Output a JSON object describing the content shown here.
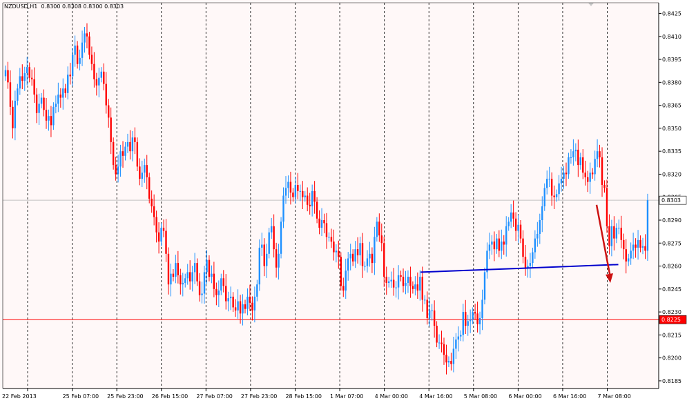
{
  "header": {
    "symbol": "NZDUSD,H1",
    "ohlc": "0.8300 0.8308 0.8300 0.8303"
  },
  "colors": {
    "background": "#fff8f8",
    "bull": "#1e90ff",
    "bear": "#ff0000",
    "grid": "#000000",
    "support_line": "#0000cd",
    "arrow": "#cc1111",
    "price_line": "#c0c0c0",
    "level_line": "#ff0000"
  },
  "chart_data": {
    "type": "candlestick",
    "title": "NZDUSD,H1",
    "ylim": [
      0.818,
      0.8432
    ],
    "y_ticks": [
      "0.8425",
      "0.8410",
      "0.8395",
      "0.8380",
      "0.8365",
      "0.8350",
      "0.8335",
      "0.8320",
      "0.8305",
      "0.8290",
      "0.8275",
      "0.8260",
      "0.8245",
      "0.8230",
      "0.8215",
      "0.8200",
      "0.8185"
    ],
    "x_ticks": [
      "22 Feb 2013",
      "25 Feb 07:00",
      "25 Feb 23:00",
      "26 Feb 15:00",
      "27 Feb 07:00",
      "27 Feb 23:00",
      "28 Feb 15:00",
      "1 Mar 07:00",
      "4 Mar 00:00",
      "4 Mar 16:00",
      "5 Mar 08:00",
      "6 Mar 00:00",
      "6 Mar 16:00",
      "7 Mar 08:00"
    ],
    "current_price": "0.8303",
    "horizontal_level": "0.8225",
    "trendline": {
      "from": [
        "4 Mar 16:00",
        0.8256
      ],
      "to": [
        "7 Mar 08:00",
        0.8261
      ]
    },
    "forecast_arrow": {
      "from_price": 0.83,
      "to_price": 0.8249,
      "direction": "down"
    },
    "closes": [
      0.8388,
      0.838,
      0.8364,
      0.835,
      0.8368,
      0.8376,
      0.8384,
      0.8381,
      0.8386,
      0.839,
      0.8383,
      0.8382,
      0.8372,
      0.836,
      0.8366,
      0.837,
      0.8362,
      0.8355,
      0.8358,
      0.8352,
      0.8364,
      0.8366,
      0.8372,
      0.837,
      0.8376,
      0.8373,
      0.8385,
      0.8384,
      0.8398,
      0.8404,
      0.8392,
      0.8396,
      0.8406,
      0.8412,
      0.841,
      0.8398,
      0.8392,
      0.8382,
      0.8378,
      0.8383,
      0.8387,
      0.8379,
      0.8365,
      0.8357,
      0.8341,
      0.8326,
      0.832,
      0.8325,
      0.8335,
      0.8332,
      0.8338,
      0.8341,
      0.8335,
      0.8344,
      0.8341,
      0.8325,
      0.8317,
      0.8321,
      0.8326,
      0.8318,
      0.8304,
      0.8299,
      0.8292,
      0.8282,
      0.8276,
      0.8285,
      0.8283,
      0.8268,
      0.8248,
      0.8255,
      0.8253,
      0.8262,
      0.8254,
      0.8248,
      0.8249,
      0.8252,
      0.8256,
      0.825,
      0.8256,
      0.8262,
      0.825,
      0.8241,
      0.8242,
      0.8256,
      0.8264,
      0.8253,
      0.8255,
      0.8245,
      0.8241,
      0.8244,
      0.8252,
      0.8247,
      0.8237,
      0.8239,
      0.824,
      0.8233,
      0.8231,
      0.8237,
      0.8229,
      0.8235,
      0.8232,
      0.824,
      0.8236,
      0.8231,
      0.824,
      0.8248,
      0.8272,
      0.8274,
      0.826,
      0.8268,
      0.8282,
      0.8286,
      0.8271,
      0.8259,
      0.8268,
      0.8289,
      0.8306,
      0.8311,
      0.8315,
      0.8308,
      0.8305,
      0.8313,
      0.8309,
      0.8309,
      0.8305,
      0.8306,
      0.83,
      0.8299,
      0.8309,
      0.8302,
      0.8291,
      0.8285,
      0.829,
      0.8288,
      0.8279,
      0.8279,
      0.8276,
      0.8269,
      0.827,
      0.8266,
      0.8247,
      0.8244,
      0.8257,
      0.8265,
      0.8268,
      0.8263,
      0.8271,
      0.8267,
      0.8275,
      0.826,
      0.826,
      0.8265,
      0.8268,
      0.8262,
      0.8279,
      0.8289,
      0.828,
      0.8275,
      0.8253,
      0.8249,
      0.825,
      0.8251,
      0.8246,
      0.8246,
      0.8254,
      0.8253,
      0.8247,
      0.8249,
      0.8253,
      0.8247,
      0.8245,
      0.8248,
      0.8244,
      0.8253,
      0.8238,
      0.8238,
      0.8226,
      0.8231,
      0.8231,
      0.8221,
      0.821,
      0.821,
      0.8209,
      0.8202,
      0.8197,
      0.8198,
      0.8196,
      0.8206,
      0.8212,
      0.8214,
      0.8215,
      0.823,
      0.8221,
      0.8224,
      0.8225,
      0.823,
      0.8229,
      0.8222,
      0.8226,
      0.8238,
      0.8256,
      0.827,
      0.8274,
      0.8276,
      0.8271,
      0.8278,
      0.827,
      0.8276,
      0.8274,
      0.8286,
      0.8289,
      0.8295,
      0.8291,
      0.8283,
      0.8287,
      0.8278,
      0.8266,
      0.8259,
      0.826,
      0.8262,
      0.8269,
      0.8278,
      0.8281,
      0.829,
      0.8299,
      0.8311,
      0.8317,
      0.8317,
      0.8306,
      0.8305,
      0.8307,
      0.8314,
      0.8317,
      0.8321,
      0.832,
      0.8331,
      0.8331,
      0.8335,
      0.8336,
      0.8326,
      0.8331,
      0.8321,
      0.8318,
      0.8315,
      0.8321,
      0.832,
      0.833,
      0.8335,
      0.8331,
      0.8313,
      0.8311,
      0.8286,
      0.8273,
      0.8286,
      0.8278,
      0.8285,
      0.8285,
      0.8277,
      0.8271,
      0.8263,
      0.8265,
      0.827,
      0.8274,
      0.8272,
      0.8277,
      0.8272,
      0.8273,
      0.827,
      0.8303
    ]
  }
}
